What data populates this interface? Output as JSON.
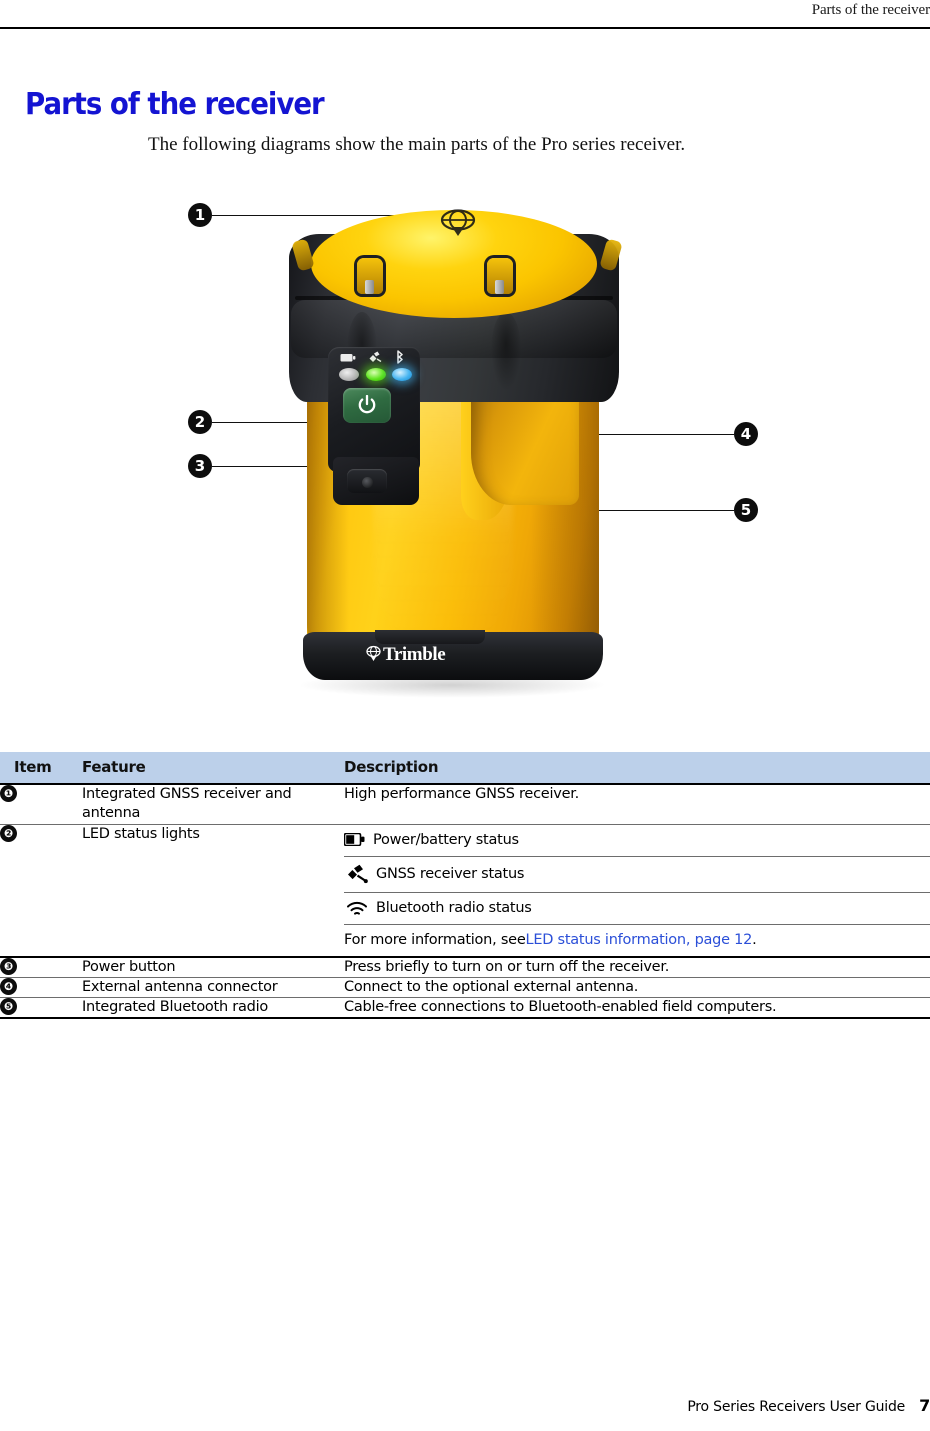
{
  "header": {
    "running_head": "Parts of the receiver"
  },
  "page": {
    "title": "Parts of the receiver",
    "intro": "The following diagrams show the main parts of the Pro series receiver."
  },
  "figure": {
    "alt": "Trimble Pro series GNSS receiver",
    "brand": "Trimble",
    "callouts": [
      {
        "id": "1",
        "label": "❶"
      },
      {
        "id": "2",
        "label": "❷"
      },
      {
        "id": "3",
        "label": "❸"
      },
      {
        "id": "4",
        "label": "❹"
      },
      {
        "id": "5",
        "label": "❺"
      }
    ],
    "leds": [
      {
        "name": "power-battery-led",
        "color": "#a9a9a9",
        "state": "off"
      },
      {
        "name": "gnss-led",
        "color": "#5ee41e",
        "state": "on"
      },
      {
        "name": "bluetooth-led",
        "color": "#46b4f0",
        "state": "on"
      }
    ],
    "power_button_color": "#2f6b41"
  },
  "table": {
    "columns": [
      "Item",
      "Feature",
      "Description"
    ],
    "rows": [
      {
        "item": "❶",
        "feature": "Integrated GNSS receiver and antenna",
        "description": "High performance GNSS receiver."
      },
      {
        "item": "❷",
        "feature": "LED status lights",
        "sub_rows": [
          {
            "icon": "battery-icon",
            "text": "Power/battery status"
          },
          {
            "icon": "satellite-icon",
            "text": "GNSS receiver status"
          },
          {
            "icon": "bluetooth-radio-icon",
            "text": "Bluetooth radio status"
          }
        ],
        "note_prefix": "For more information, see ",
        "note_link": "LED status information, page 12",
        "note_suffix": "."
      },
      {
        "item": "❸",
        "feature": "Power button",
        "description": "Press briefly to turn on or turn off the receiver."
      },
      {
        "item": "❹",
        "feature": "External antenna connector",
        "description": "Connect to the optional external antenna."
      },
      {
        "item": "❺",
        "feature": "Integrated Bluetooth radio",
        "description": "Cable-free connections to Bluetooth-enabled field computers."
      }
    ]
  },
  "footer": {
    "guide_title": "Pro Series Receivers User Guide",
    "page_number": "7"
  },
  "colors": {
    "heading": "#1414d2",
    "link": "#2b4fd8",
    "table_header_bg": "#bcd0ea",
    "device_yellow": "#ffc710",
    "device_black": "#2c2e33"
  }
}
